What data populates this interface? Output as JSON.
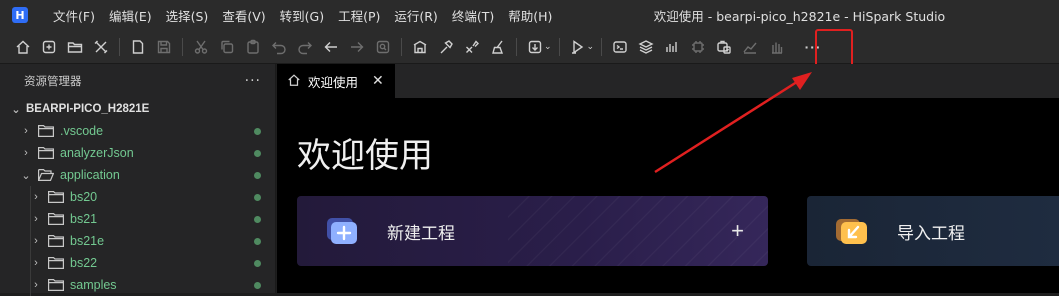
{
  "app": {
    "logo_text": "H",
    "window_title": "欢迎使用 - bearpi-pico_h2821e - HiSpark Studio"
  },
  "menu": [
    {
      "label": "文件(F)"
    },
    {
      "label": "编辑(E)"
    },
    {
      "label": "选择(S)"
    },
    {
      "label": "查看(V)"
    },
    {
      "label": "转到(G)"
    },
    {
      "label": "工程(P)"
    },
    {
      "label": "运行(R)"
    },
    {
      "label": "终端(T)"
    },
    {
      "label": "帮助(H)"
    }
  ],
  "toolbar": {
    "icons": [
      "home-icon",
      "new-file-icon",
      "open-folder-icon",
      "tools-icon",
      "new-document-icon",
      "save-icon",
      "cut-icon",
      "copy-icon",
      "paste-icon",
      "undo-icon",
      "redo-icon",
      "back-icon",
      "forward-icon",
      "search-icon",
      "build-icon",
      "hammer-icon",
      "rebuild-icon",
      "clean-icon",
      "download-icon",
      "debug-icon",
      "terminal-icon",
      "layers-icon",
      "chart-bars-icon",
      "chip-icon",
      "package-icon",
      "trend-icon",
      "hand-icon",
      "more-icon"
    ],
    "highlight_color": "#e02020"
  },
  "sidebar": {
    "title": "资源管理器",
    "more": "···",
    "project": "BEARPI-PICO_H2821E",
    "items": [
      {
        "label": ".vscode",
        "expanded": false,
        "level": 1
      },
      {
        "label": "analyzerJson",
        "expanded": false,
        "level": 1
      },
      {
        "label": "application",
        "expanded": true,
        "level": 1
      },
      {
        "label": "bs20",
        "expanded": false,
        "level": 2
      },
      {
        "label": "bs21",
        "expanded": false,
        "level": 2
      },
      {
        "label": "bs21e",
        "expanded": false,
        "level": 2
      },
      {
        "label": "bs22",
        "expanded": false,
        "level": 2
      },
      {
        "label": "samples",
        "expanded": false,
        "level": 2
      }
    ],
    "status_color": "#4f8a60",
    "label_color": "#73c991"
  },
  "editor": {
    "tab_label": "欢迎使用",
    "tab_close": "✕",
    "welcome_title": "欢迎使用",
    "cards": {
      "new_project": {
        "label": "新建工程",
        "action": "+"
      },
      "import_project": {
        "label": "导入工程"
      }
    }
  }
}
